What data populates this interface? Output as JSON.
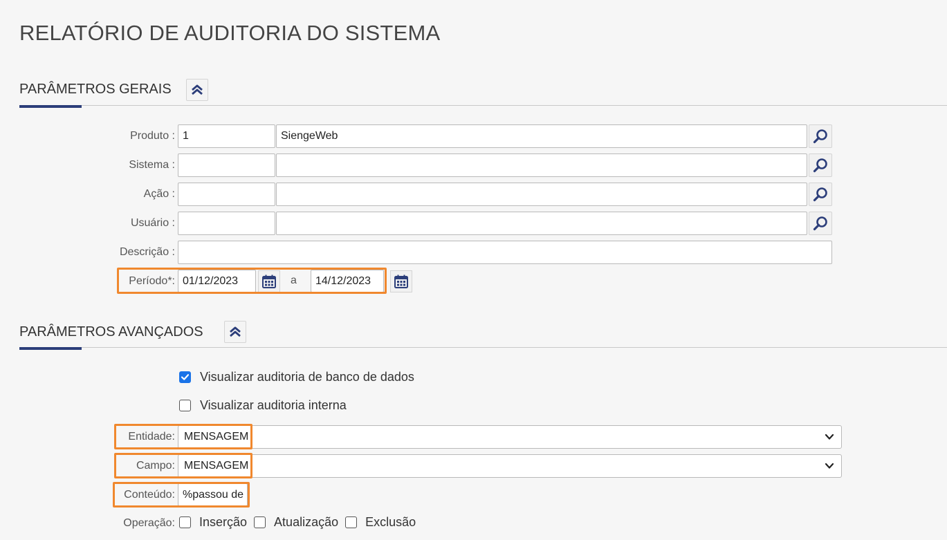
{
  "page": {
    "title": "RELATÓRIO DE AUDITORIA DO SISTEMA"
  },
  "general": {
    "title": "PARÂMETROS GERAIS",
    "produto": {
      "label": "Produto :",
      "code": "1",
      "desc": "SiengeWeb"
    },
    "sistema": {
      "label": "Sistema :",
      "code": "",
      "desc": ""
    },
    "acao": {
      "label": "Ação :",
      "code": "",
      "desc": ""
    },
    "usuario": {
      "label": "Usuário :",
      "code": "",
      "desc": ""
    },
    "descricao": {
      "label": "Descrição :",
      "value": ""
    },
    "periodo": {
      "label": "Período*:",
      "start": "01/12/2023",
      "separator": "a",
      "end": "14/12/2023"
    }
  },
  "advanced": {
    "title": "PARÂMETROS AVANÇADOS",
    "db_audit": {
      "label": "Visualizar auditoria de banco de dados",
      "checked": true
    },
    "internal_audit": {
      "label": "Visualizar auditoria interna",
      "checked": false
    },
    "entidade": {
      "label": "Entidade:",
      "value": "MENSAGEM"
    },
    "campo": {
      "label": "Campo:",
      "value": "MENSAGEM"
    },
    "conteudo": {
      "label": "Conteúdo:",
      "value": "%passou de"
    },
    "operacao": {
      "label": "Operação:",
      "options": [
        {
          "label": "Inserção",
          "checked": false
        },
        {
          "label": "Atualização",
          "checked": false
        },
        {
          "label": "Exclusão",
          "checked": false
        }
      ]
    }
  },
  "colors": {
    "accent": "#2c3e7a",
    "highlight": "#f0882e",
    "checkbox": "#1a73e8"
  },
  "icons": {
    "collapse": "double-chevron-up-icon",
    "search": "magnifier-icon",
    "calendar": "calendar-icon",
    "dropdown": "chevron-down-icon"
  }
}
